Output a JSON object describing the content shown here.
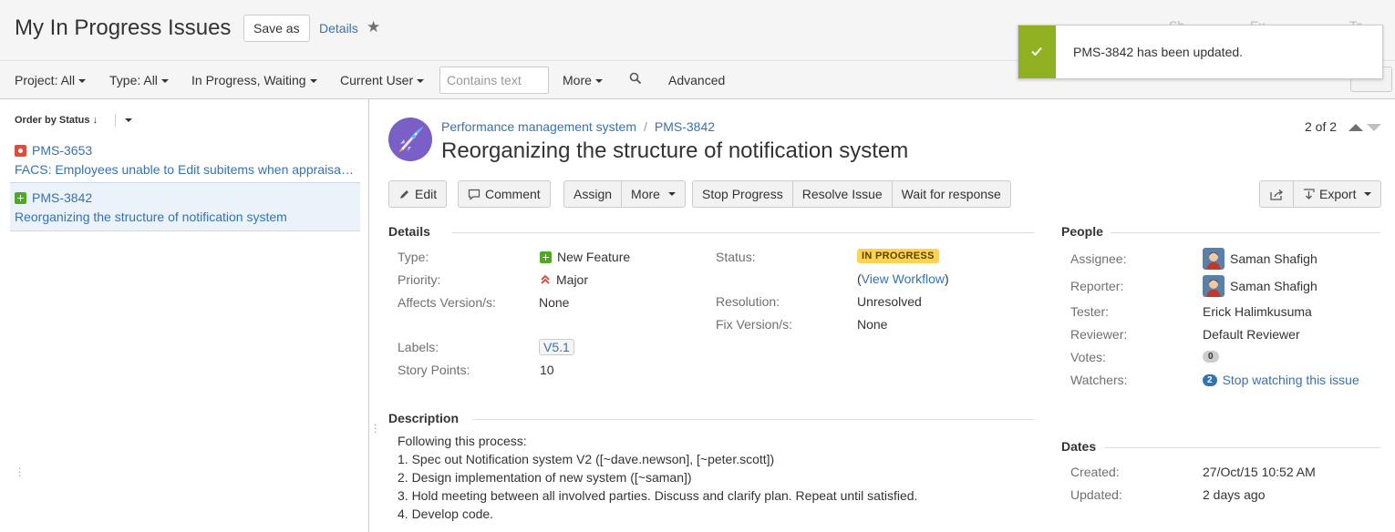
{
  "header": {
    "title": "My In Progress Issues",
    "save_as": "Save as",
    "details": "Details",
    "faint_right_1": "Sh",
    "faint_right_2": "Ex",
    "faint_right_3": "To"
  },
  "filters": {
    "project": "Project: All",
    "type": "Type: All",
    "status": "In Progress, Waiting",
    "assignee": "Current User",
    "search_placeholder": "Contains text",
    "more": "More",
    "advanced": "Advanced"
  },
  "toast": {
    "message": "PMS-3842 has been updated."
  },
  "list": {
    "order_by": "Order by Status",
    "items": [
      {
        "key": "PMS-3653",
        "summary": "FACS: Employees unable to Edit subitems when appraisal is ...",
        "type": "bug"
      },
      {
        "key": "PMS-3842",
        "summary": "Reorganizing the structure of notification system",
        "type": "feature"
      }
    ]
  },
  "issue": {
    "project": "Performance management system",
    "key": "PMS-3842",
    "summary": "Reorganizing the structure of notification system",
    "pager": "2 of 2",
    "actions": {
      "edit": "Edit",
      "comment": "Comment",
      "assign": "Assign",
      "more": "More",
      "stop_progress": "Stop Progress",
      "resolve": "Resolve Issue",
      "wait": "Wait for response",
      "export": "Export"
    },
    "details": {
      "heading": "Details",
      "type_label": "Type:",
      "type_value": "New Feature",
      "priority_label": "Priority:",
      "priority_value": "Major",
      "affects_label": "Affects Version/s:",
      "affects_value": "None",
      "labels_label": "Labels:",
      "labels_value": "V5.1",
      "points_label": "Story Points:",
      "points_value": "10",
      "status_label": "Status:",
      "status_value": "IN PROGRESS",
      "workflow_open": "(",
      "workflow_link": "View Workflow",
      "workflow_close": ")",
      "resolution_label": "Resolution:",
      "resolution_value": "Unresolved",
      "fix_label": "Fix Version/s:",
      "fix_value": "None"
    },
    "description": {
      "heading": "Description",
      "lines": [
        "Following this process:",
        "1. Spec out Notification system V2 ([~dave.newson], [~peter.scott])",
        "2. Design implementation of new system ([~saman])",
        "3. Hold meeting between all involved parties. Discuss and clarify plan. Repeat until satisfied.",
        "4. Develop code."
      ]
    },
    "people": {
      "heading": "People",
      "assignee_label": "Assignee:",
      "assignee_value": "Saman Shafigh",
      "reporter_label": "Reporter:",
      "reporter_value": "Saman Shafigh",
      "tester_label": "Tester:",
      "tester_value": "Erick Halimkusuma",
      "reviewer_label": "Reviewer:",
      "reviewer_value": "Default Reviewer",
      "votes_label": "Votes:",
      "votes_value": "0",
      "watchers_label": "Watchers:",
      "watchers_count": "2",
      "watchers_link": "Stop watching this issue"
    },
    "dates": {
      "heading": "Dates",
      "created_label": "Created:",
      "created_value": "27/Oct/15 10:52 AM",
      "updated_label": "Updated:",
      "updated_value": "2 days ago"
    }
  },
  "colors": {
    "link": "#3572b0",
    "toast_accent": "#8eb021",
    "in_progress": "#ffd351",
    "bug": "#e5493a",
    "feature": "#51a825"
  }
}
